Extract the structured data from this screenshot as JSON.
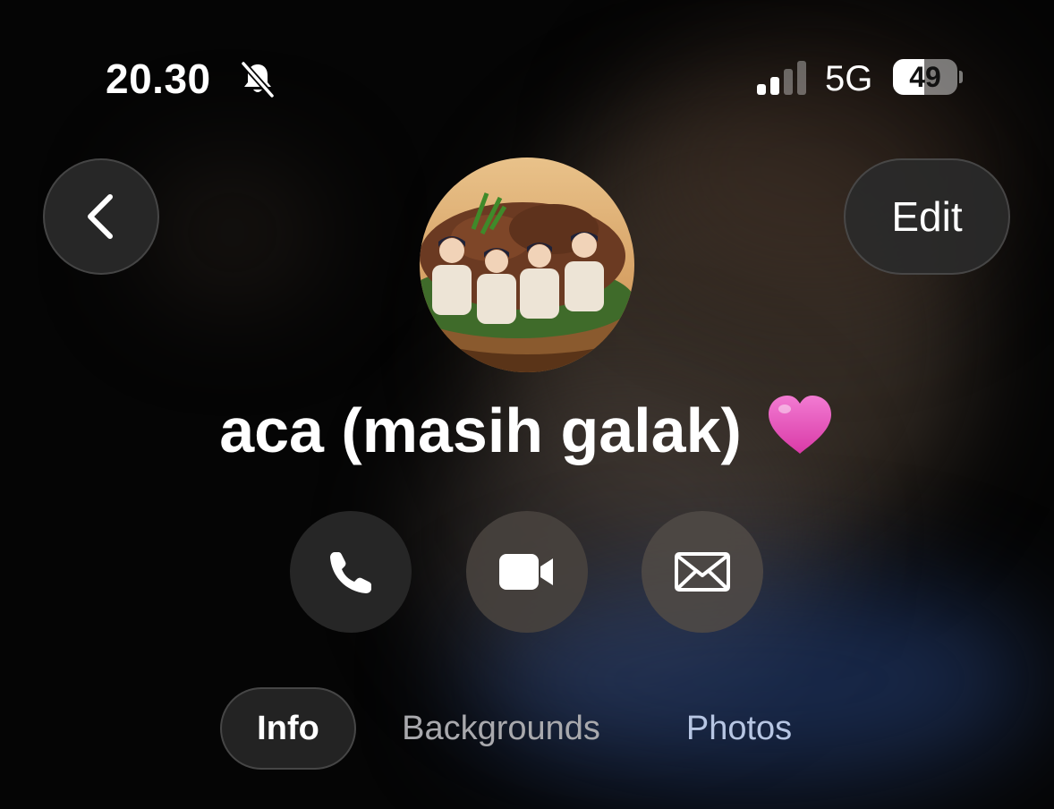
{
  "status_bar": {
    "time": "20.30",
    "network": "5G",
    "battery_percent": "49",
    "battery_level": 0.49,
    "signal_bars_active": 2,
    "signal_bars_total": 4,
    "icons": [
      "bell-slash-icon",
      "signal-icon",
      "battery-icon"
    ]
  },
  "header": {
    "back_icon": "chevron-left-icon",
    "edit_label": "Edit"
  },
  "contact": {
    "name": "aca (masih galak)",
    "emoji": "pink-heart-icon"
  },
  "actions": [
    {
      "name": "call",
      "icon": "phone-icon"
    },
    {
      "name": "video",
      "icon": "video-camera-icon"
    },
    {
      "name": "mail",
      "icon": "envelope-icon"
    }
  ],
  "tabs": [
    {
      "label": "Info",
      "selected": true
    },
    {
      "label": "Backgrounds",
      "selected": false
    },
    {
      "label": "Photos",
      "selected": false
    }
  ],
  "colors": {
    "background": "#050505",
    "button_bg": "#2a2a2a",
    "tab_inactive": "#a9a9ad",
    "tab_photos": "#b7c6e3",
    "heart": "#e34fb8"
  }
}
